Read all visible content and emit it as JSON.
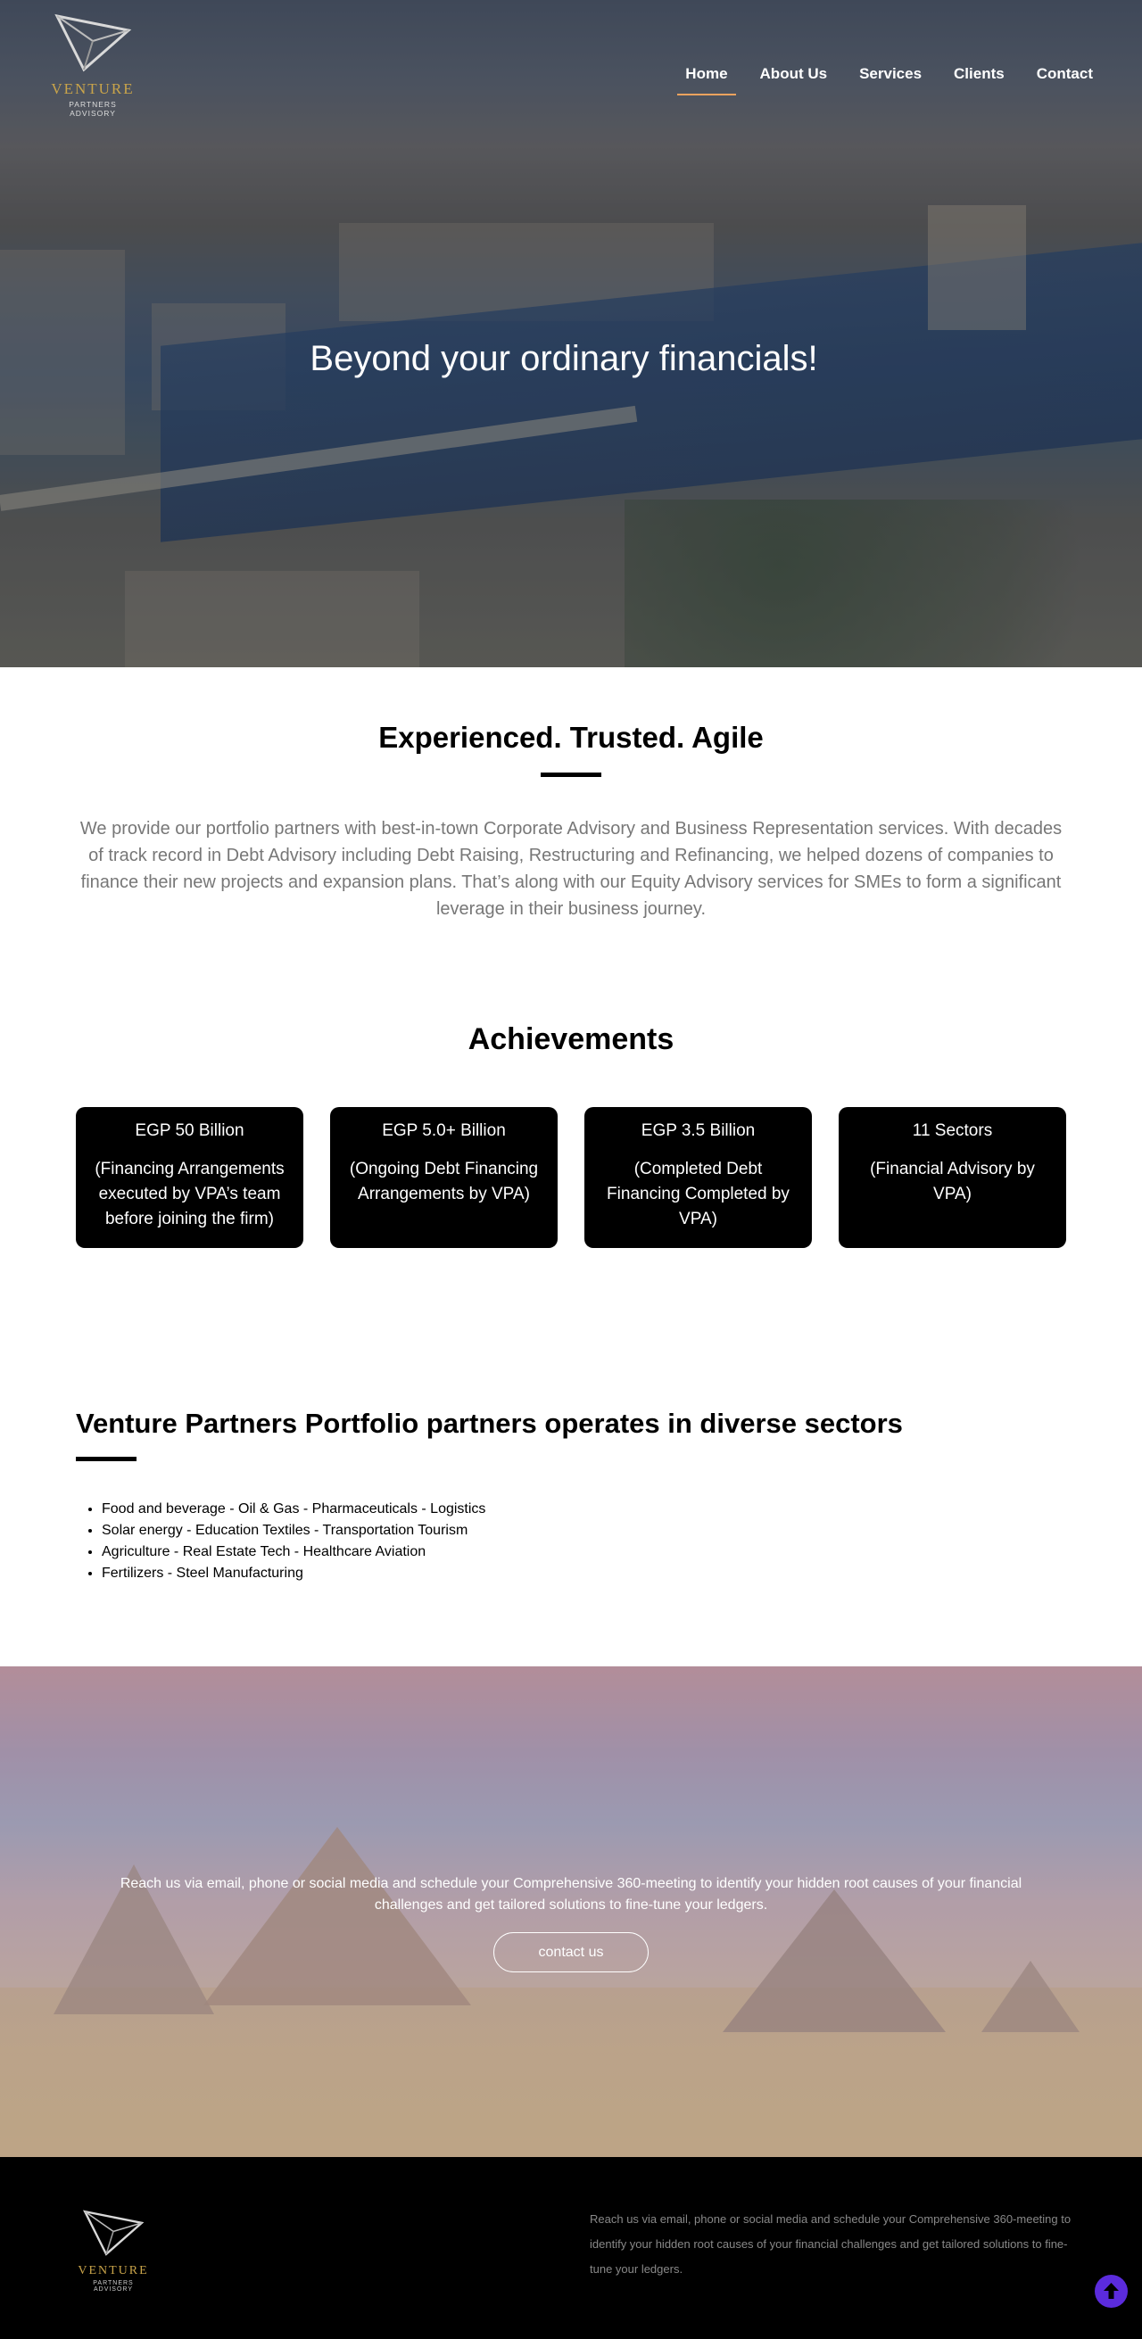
{
  "header": {
    "brand": "VENTURE",
    "brand_sub": "PARTNERS ADVISORY",
    "nav": [
      {
        "label": "Home",
        "active": true
      },
      {
        "label": "About Us"
      },
      {
        "label": "Services"
      },
      {
        "label": "Clients"
      },
      {
        "label": "Contact"
      }
    ]
  },
  "hero": {
    "title": "Beyond your ordinary financials!"
  },
  "intro": {
    "title": "Experienced. Trusted. Agile",
    "text": "We provide our portfolio partners with best-in-town Corporate Advisory and Business Representation services. With decades of track record in Debt Advisory including Debt Raising, Restructuring and Refinancing, we helped dozens of companies to finance their new projects and expansion plans. That’s along with our Equity Advisory services for SMEs to form a significant leverage in their business journey."
  },
  "achievements": {
    "title": "Achievements",
    "cards": [
      {
        "value": "EGP 50 Billion",
        "desc": "(Financing Arrangements executed by VPA’s team before joining the firm)"
      },
      {
        "value": "EGP 5.0+ Billion",
        "desc": "(Ongoing Debt Financing Arrangements by VPA)"
      },
      {
        "value": "EGP 3.5 Billion",
        "desc": "(Completed Debt Financing Completed by VPA)"
      },
      {
        "value": "11 Sectors",
        "desc": "(Financial Advisory by VPA)"
      }
    ]
  },
  "sectors": {
    "title": "Venture Partners Portfolio partners operates in diverse sectors",
    "items": [
      "Food and beverage - Oil & Gas - Pharmaceuticals - Logistics",
      "Solar energy - Education Textiles - Transportation Tourism",
      "Agriculture - Real Estate Tech - Healthcare Aviation",
      "Fertilizers - Steel Manufacturing"
    ]
  },
  "cta": {
    "text": "Reach us via email, phone or social media and schedule your Comprehensive 360-meeting to identify your hidden root causes of your financial challenges and get tailored solutions to fine-tune your ledgers.",
    "button": "contact us"
  },
  "footer": {
    "brand": "VENTURE",
    "brand_sub": "PARTNERS ADVISORY",
    "text": "Reach us via email, phone or social media and schedule your Comprehensive 360-meeting to identify your hidden root causes of your financial challenges and get tailored solutions to fine-tune your ledgers."
  },
  "colors": {
    "accent_underline": "#f0a35e",
    "brand_gold": "#c9a44a",
    "back_to_top": "#5b2bdc"
  },
  "icons": {
    "logo": "triangle-logo-icon",
    "back_to_top": "arrow-up-icon"
  }
}
